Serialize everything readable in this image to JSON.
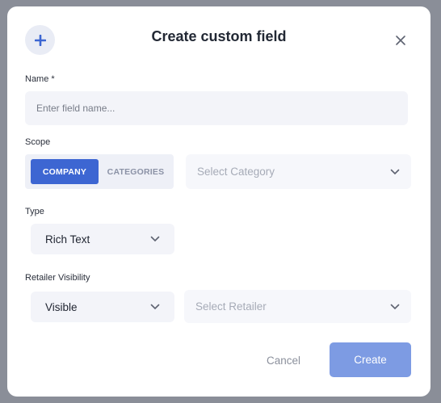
{
  "modal": {
    "title": "Create custom field",
    "name_label": "Name *",
    "name_placeholder": "Enter field name...",
    "scope_label": "Scope",
    "scope_options": [
      "COMPANY",
      "CATEGORIES"
    ],
    "category_placeholder": "Select Category",
    "type_label": "Type",
    "type_value": "Rich Text",
    "visibility_label": "Retailer Visibility",
    "visibility_value": "Visible",
    "retailer_placeholder": "Select Retailer",
    "cancel_label": "Cancel",
    "create_label": "Create"
  },
  "icons": {
    "header": "plus-icon",
    "close": "close-icon",
    "dropdown": "chevron-down-icon"
  },
  "colors": {
    "accent": "#3d66d2",
    "create_button": "#7d9be3"
  }
}
